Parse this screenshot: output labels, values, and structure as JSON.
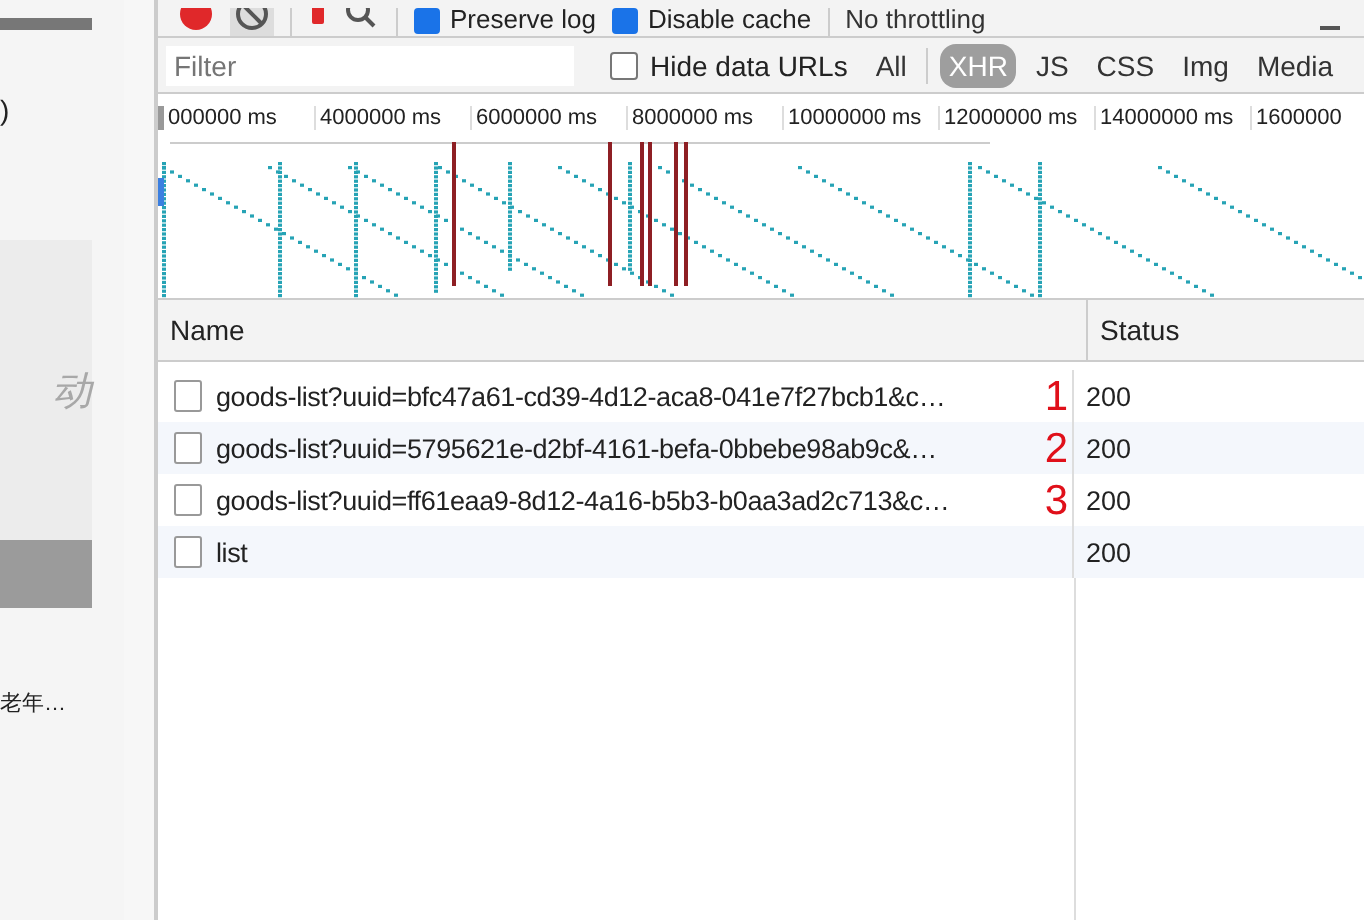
{
  "page_strip": {
    "texts": [
      ")",
      "动",
      "老年…"
    ]
  },
  "toolbar": {
    "items": [
      {
        "kind": "checkbox",
        "label": "Preserve log",
        "checked": true
      },
      {
        "kind": "checkbox",
        "label": "Disable cache",
        "checked": true
      },
      {
        "kind": "dropdown",
        "label": "No throttling"
      }
    ]
  },
  "filter_bar": {
    "placeholder": "Filter",
    "hide_data_urls": {
      "label": "Hide data URLs",
      "checked": false
    },
    "types": [
      {
        "label": "All",
        "selected": false
      },
      {
        "label": "XHR",
        "selected": true
      },
      {
        "label": "JS",
        "selected": false
      },
      {
        "label": "CSS",
        "selected": false
      },
      {
        "label": "Img",
        "selected": false
      },
      {
        "label": "Media",
        "selected": false
      }
    ]
  },
  "timeline": {
    "tick_labels": [
      "000000 ms",
      "4000000 ms",
      "6000000 ms",
      "8000000 ms",
      "10000000 ms",
      "12000000 ms",
      "14000000 ms",
      "1600000"
    ]
  },
  "table": {
    "columns": [
      "Name",
      "Status"
    ],
    "rows": [
      {
        "name": "goods-list?uuid=bfc47a61-cd39-4d12-aca8-041e7f27bcb1&c…",
        "status": "200",
        "annotation": "1"
      },
      {
        "name": "goods-list?uuid=5795621e-d2bf-4161-befa-0bbebe98ab9c&…",
        "status": "200",
        "annotation": "2"
      },
      {
        "name": "goods-list?uuid=ff61eaa9-8d12-4a16-b5b3-b0aa3ad2c713&c…",
        "status": "200",
        "annotation": "3"
      },
      {
        "name": "list",
        "status": "200"
      }
    ]
  }
}
